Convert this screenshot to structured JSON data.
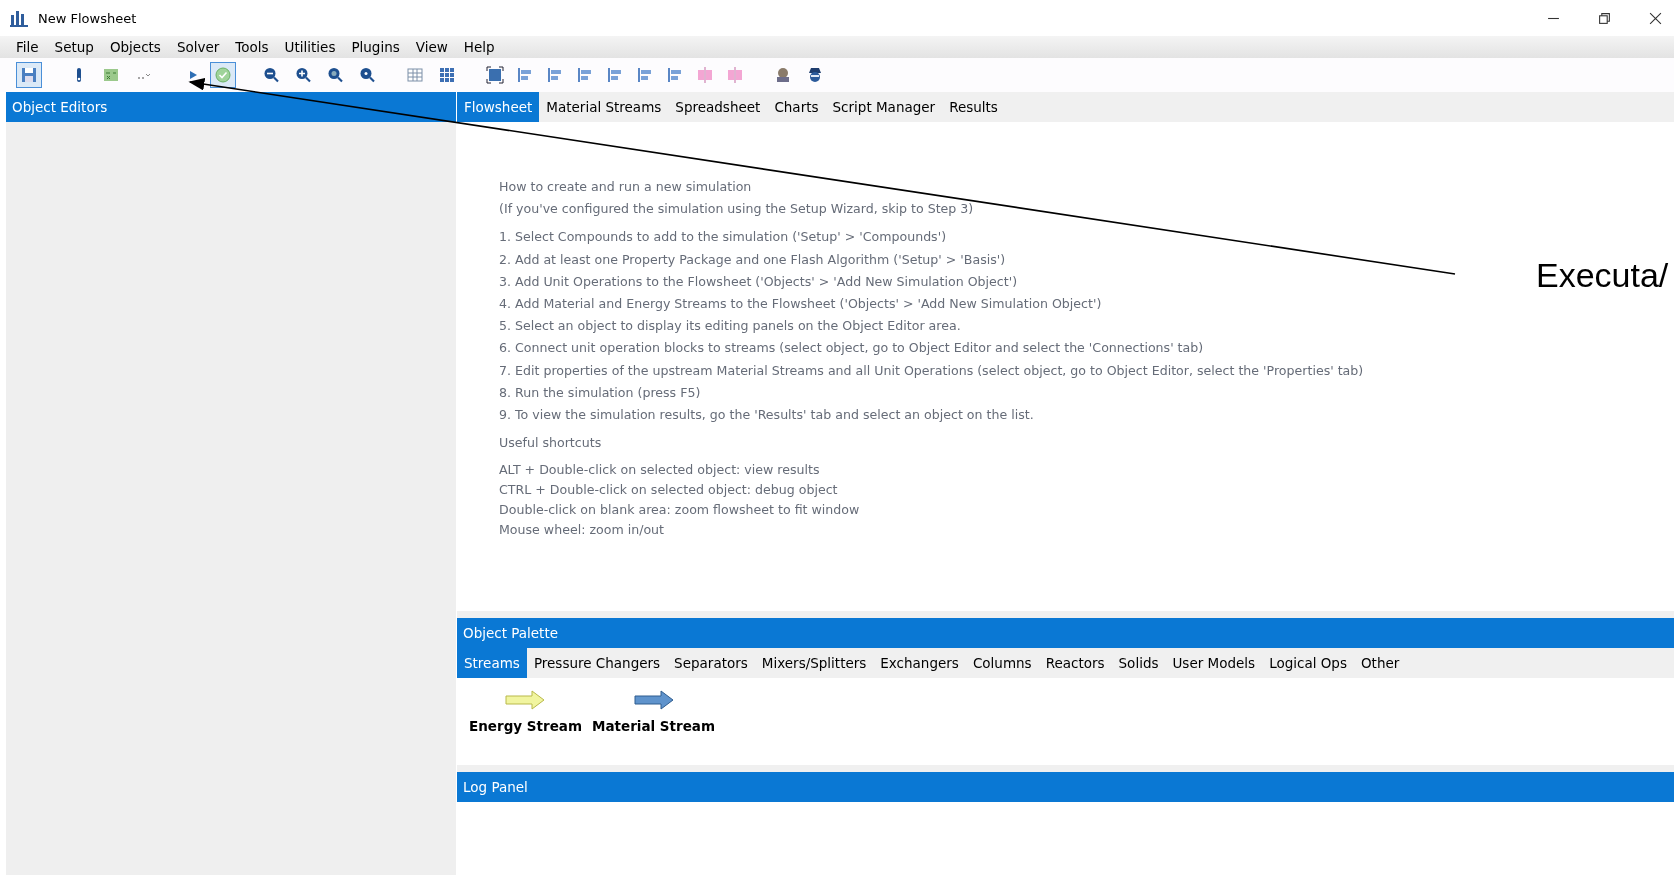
{
  "window": {
    "title": "New Flowsheet"
  },
  "menu": [
    "File",
    "Setup",
    "Objects",
    "Solver",
    "Tools",
    "Utilities",
    "Plugins",
    "View",
    "Help"
  ],
  "left_panel": {
    "title": "Object Editors"
  },
  "tabs": [
    {
      "label": "Flowsheet",
      "selected": true
    },
    {
      "label": "Material Streams",
      "selected": false
    },
    {
      "label": "Spreadsheet",
      "selected": false
    },
    {
      "label": "Charts",
      "selected": false
    },
    {
      "label": "Script Manager",
      "selected": false
    },
    {
      "label": "Results",
      "selected": false
    }
  ],
  "instructions": {
    "heading": "How to create and run a new simulation",
    "note": "(If you've configured the simulation using the Setup Wizard, skip to Step 3)",
    "steps": [
      "1. Select Compounds to add to the simulation ('Setup' > 'Compounds')",
      "2. Add at least one Property Package and one Flash Algorithm ('Setup' > 'Basis')",
      "3. Add Unit Operations to the Flowsheet ('Objects' > 'Add New Simulation Object')",
      "4. Add Material and Energy Streams to the Flowsheet ('Objects' > 'Add New Simulation Object')",
      "5. Select an object to display its editing panels on the Object Editor area.",
      "6. Connect unit operation blocks to streams (select object, go to Object Editor and select the 'Connections' tab)",
      "7. Edit properties of the upstream Material Streams and all Unit Operations (select object, go to Object Editor, select the 'Properties' tab)",
      "8. Run the simulation (press F5)",
      "9. To view the simulation results, go the 'Results' tab and select an object on the list."
    ],
    "shortcuts_heading": "Useful shortcuts",
    "shortcuts": [
      "ALT + Double-click on selected object: view results",
      "CTRL + Double-click on selected object: debug object",
      "Double-click on blank area: zoom flowsheet to fit window",
      "Mouse wheel: zoom in/out"
    ]
  },
  "palette": {
    "title": "Object Palette",
    "tabs": [
      {
        "label": "Streams",
        "selected": true
      },
      {
        "label": "Pressure Changers",
        "selected": false
      },
      {
        "label": "Separators",
        "selected": false
      },
      {
        "label": "Mixers/Splitters",
        "selected": false
      },
      {
        "label": "Exchangers",
        "selected": false
      },
      {
        "label": "Columns",
        "selected": false
      },
      {
        "label": "Reactors",
        "selected": false
      },
      {
        "label": "Solids",
        "selected": false
      },
      {
        "label": "User Models",
        "selected": false
      },
      {
        "label": "Logical Ops",
        "selected": false
      },
      {
        "label": "Other",
        "selected": false
      }
    ],
    "items": [
      {
        "label": "Energy Stream",
        "kind": "energy"
      },
      {
        "label": "Material Stream",
        "kind": "material"
      }
    ]
  },
  "log_panel": {
    "title": "Log Panel"
  },
  "annotation": {
    "text": "Executa/"
  }
}
